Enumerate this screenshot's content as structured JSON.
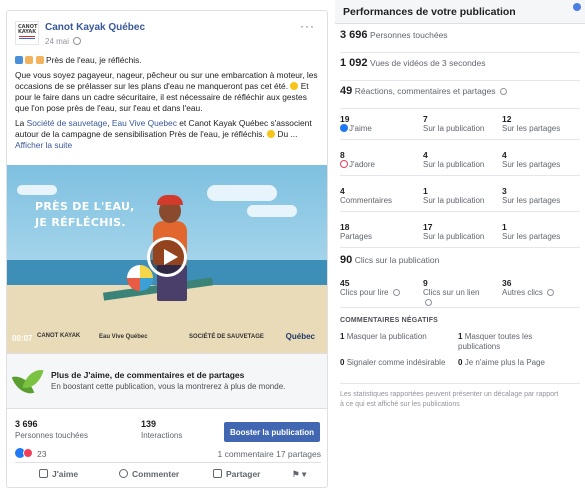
{
  "post": {
    "page_name": "Canot Kayak Québec",
    "date": "24 mai",
    "logo_text": "CANOT KAYAK",
    "paragraph1": "Près de l'eau, je réfléchis.",
    "paragraph2": "Que vous soyez pagayeur, nageur, pêcheur ou sur une embarcation à moteur, les occasions de se prélasser sur les plans d'eau ne manqueront pas cet été.",
    "paragraph2b": "Et pour le faire dans un cadre sécuritaire, il est nécessaire de réfléchir aux gestes que l'on pose près de l'eau, sur l'eau et dans l'eau.",
    "p3_pre": "La",
    "p3_link1": "Société de sauvetage",
    "p3_sep": ",",
    "p3_link2": "Eau Vive Quebec",
    "p3_rest": "et Canot Kayak Québec s'associent autour de la campagne de sensibilisation Près de l'eau, je réfléchis.",
    "p3_ellipsis": "Du ...",
    "see_more": "Afficher la suite",
    "video": {
      "title_line1": "PRÈS DE L'EAU,",
      "title_line2": "JE RÉFLÉCHIS.",
      "time": "00:07",
      "logo1": "CANOT KAYAK",
      "logo2": "Eau Vive Québec",
      "logo3": "SOCIÉTÉ DE SAUVETAGE",
      "logo4": "Québec"
    },
    "promo_title": "Plus de J'aime, de commentaires et de partages",
    "promo_sub": "En boostant cette publication, vous la montrerez à plus de monde.",
    "reach_num": "3 696",
    "reach_lbl": "Personnes touchées",
    "inter_num": "139",
    "inter_lbl": "Interactions",
    "boost_label": "Booster la publication",
    "reaction_count": "23",
    "comments_shares": "1 commentaire 17 partages",
    "action_like": "J'aime",
    "action_comment": "Commenter",
    "action_share": "Partager"
  },
  "panel": {
    "title": "Performances de votre publication",
    "reach_num": "3 696",
    "reach_lbl": "Personnes touchées",
    "views_num": "1 092",
    "views_lbl": "Vues de vidéos de 3 secondes",
    "react_num": "49",
    "react_lbl": "Réactions, commentaires et partages",
    "rows": [
      {
        "a_num": "19",
        "a_lbl": "J'aime",
        "b_num": "7",
        "b_lbl": "Sur la publication",
        "c_num": "12",
        "c_lbl": "Sur les partages"
      },
      {
        "a_num": "8",
        "a_lbl": "J'adore",
        "b_num": "4",
        "b_lbl": "Sur la publication",
        "c_num": "4",
        "c_lbl": "Sur les partages"
      },
      {
        "a_num": "4",
        "a_lbl": "Commentaires",
        "b_num": "1",
        "b_lbl": "Sur la publication",
        "c_num": "3",
        "c_lbl": "Sur les partages"
      },
      {
        "a_num": "18",
        "a_lbl": "Partages",
        "b_num": "17",
        "b_lbl": "Sur la publication",
        "c_num": "1",
        "c_lbl": "Sur les partages"
      }
    ],
    "clicks_num": "90",
    "clicks_lbl": "Clics sur la publication",
    "clicks": {
      "a_num": "45",
      "a_lbl": "Clics pour lire",
      "b_num": "9",
      "b_lbl": "Clics sur un lien",
      "c_num": "36",
      "c_lbl": "Autres clics"
    },
    "neg_title": "COMMENTAIRES NÉGATIFS",
    "neg": {
      "a_num": "1",
      "a_lbl": "Masquer la publication",
      "b_num": "1",
      "b_lbl": "Masquer toutes les publications",
      "c_num": "0",
      "c_lbl": "Signaler comme indésirable",
      "d_num": "0",
      "d_lbl": "Je n'aime plus la Page"
    },
    "disclaimer": "Les statistiques rapportées peuvent présenter un décalage par rapport à ce qui est affiché sur les publications"
  },
  "colors": {
    "accent": "#4267b2",
    "link": "#385898",
    "like": "#2078f4",
    "love": "#f33e58"
  }
}
